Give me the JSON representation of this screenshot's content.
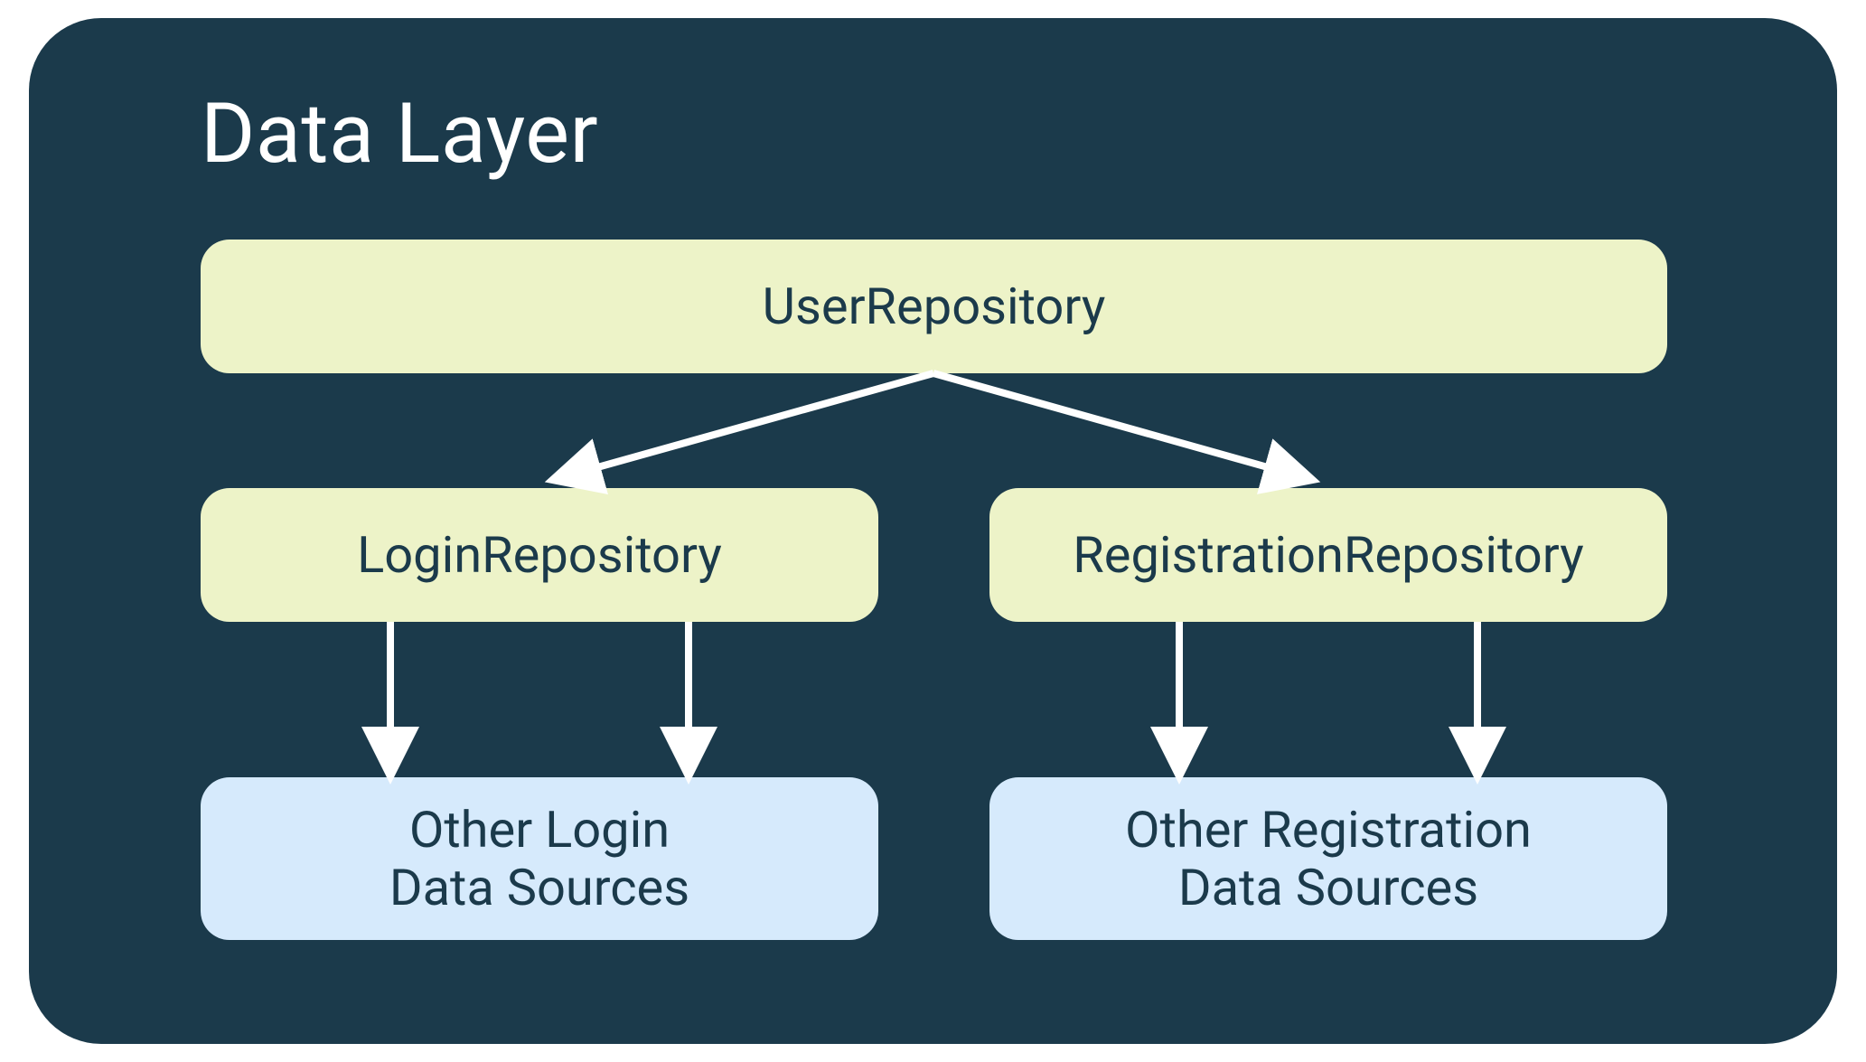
{
  "title": "Data Layer",
  "nodes": {
    "user_repo": "UserRepository",
    "login_repo": "LoginRepository",
    "registration_repo": "RegistrationRepository",
    "login_sources": "Other Login\nData Sources",
    "registration_sources": "Other Registration\nData Sources"
  },
  "colors": {
    "panel_bg": "#1b3a4b",
    "box_green": "#edf3c8",
    "box_blue": "#d6eafc",
    "arrow": "#ffffff",
    "text_dark": "#1b3a4b",
    "text_light": "#ffffff"
  }
}
